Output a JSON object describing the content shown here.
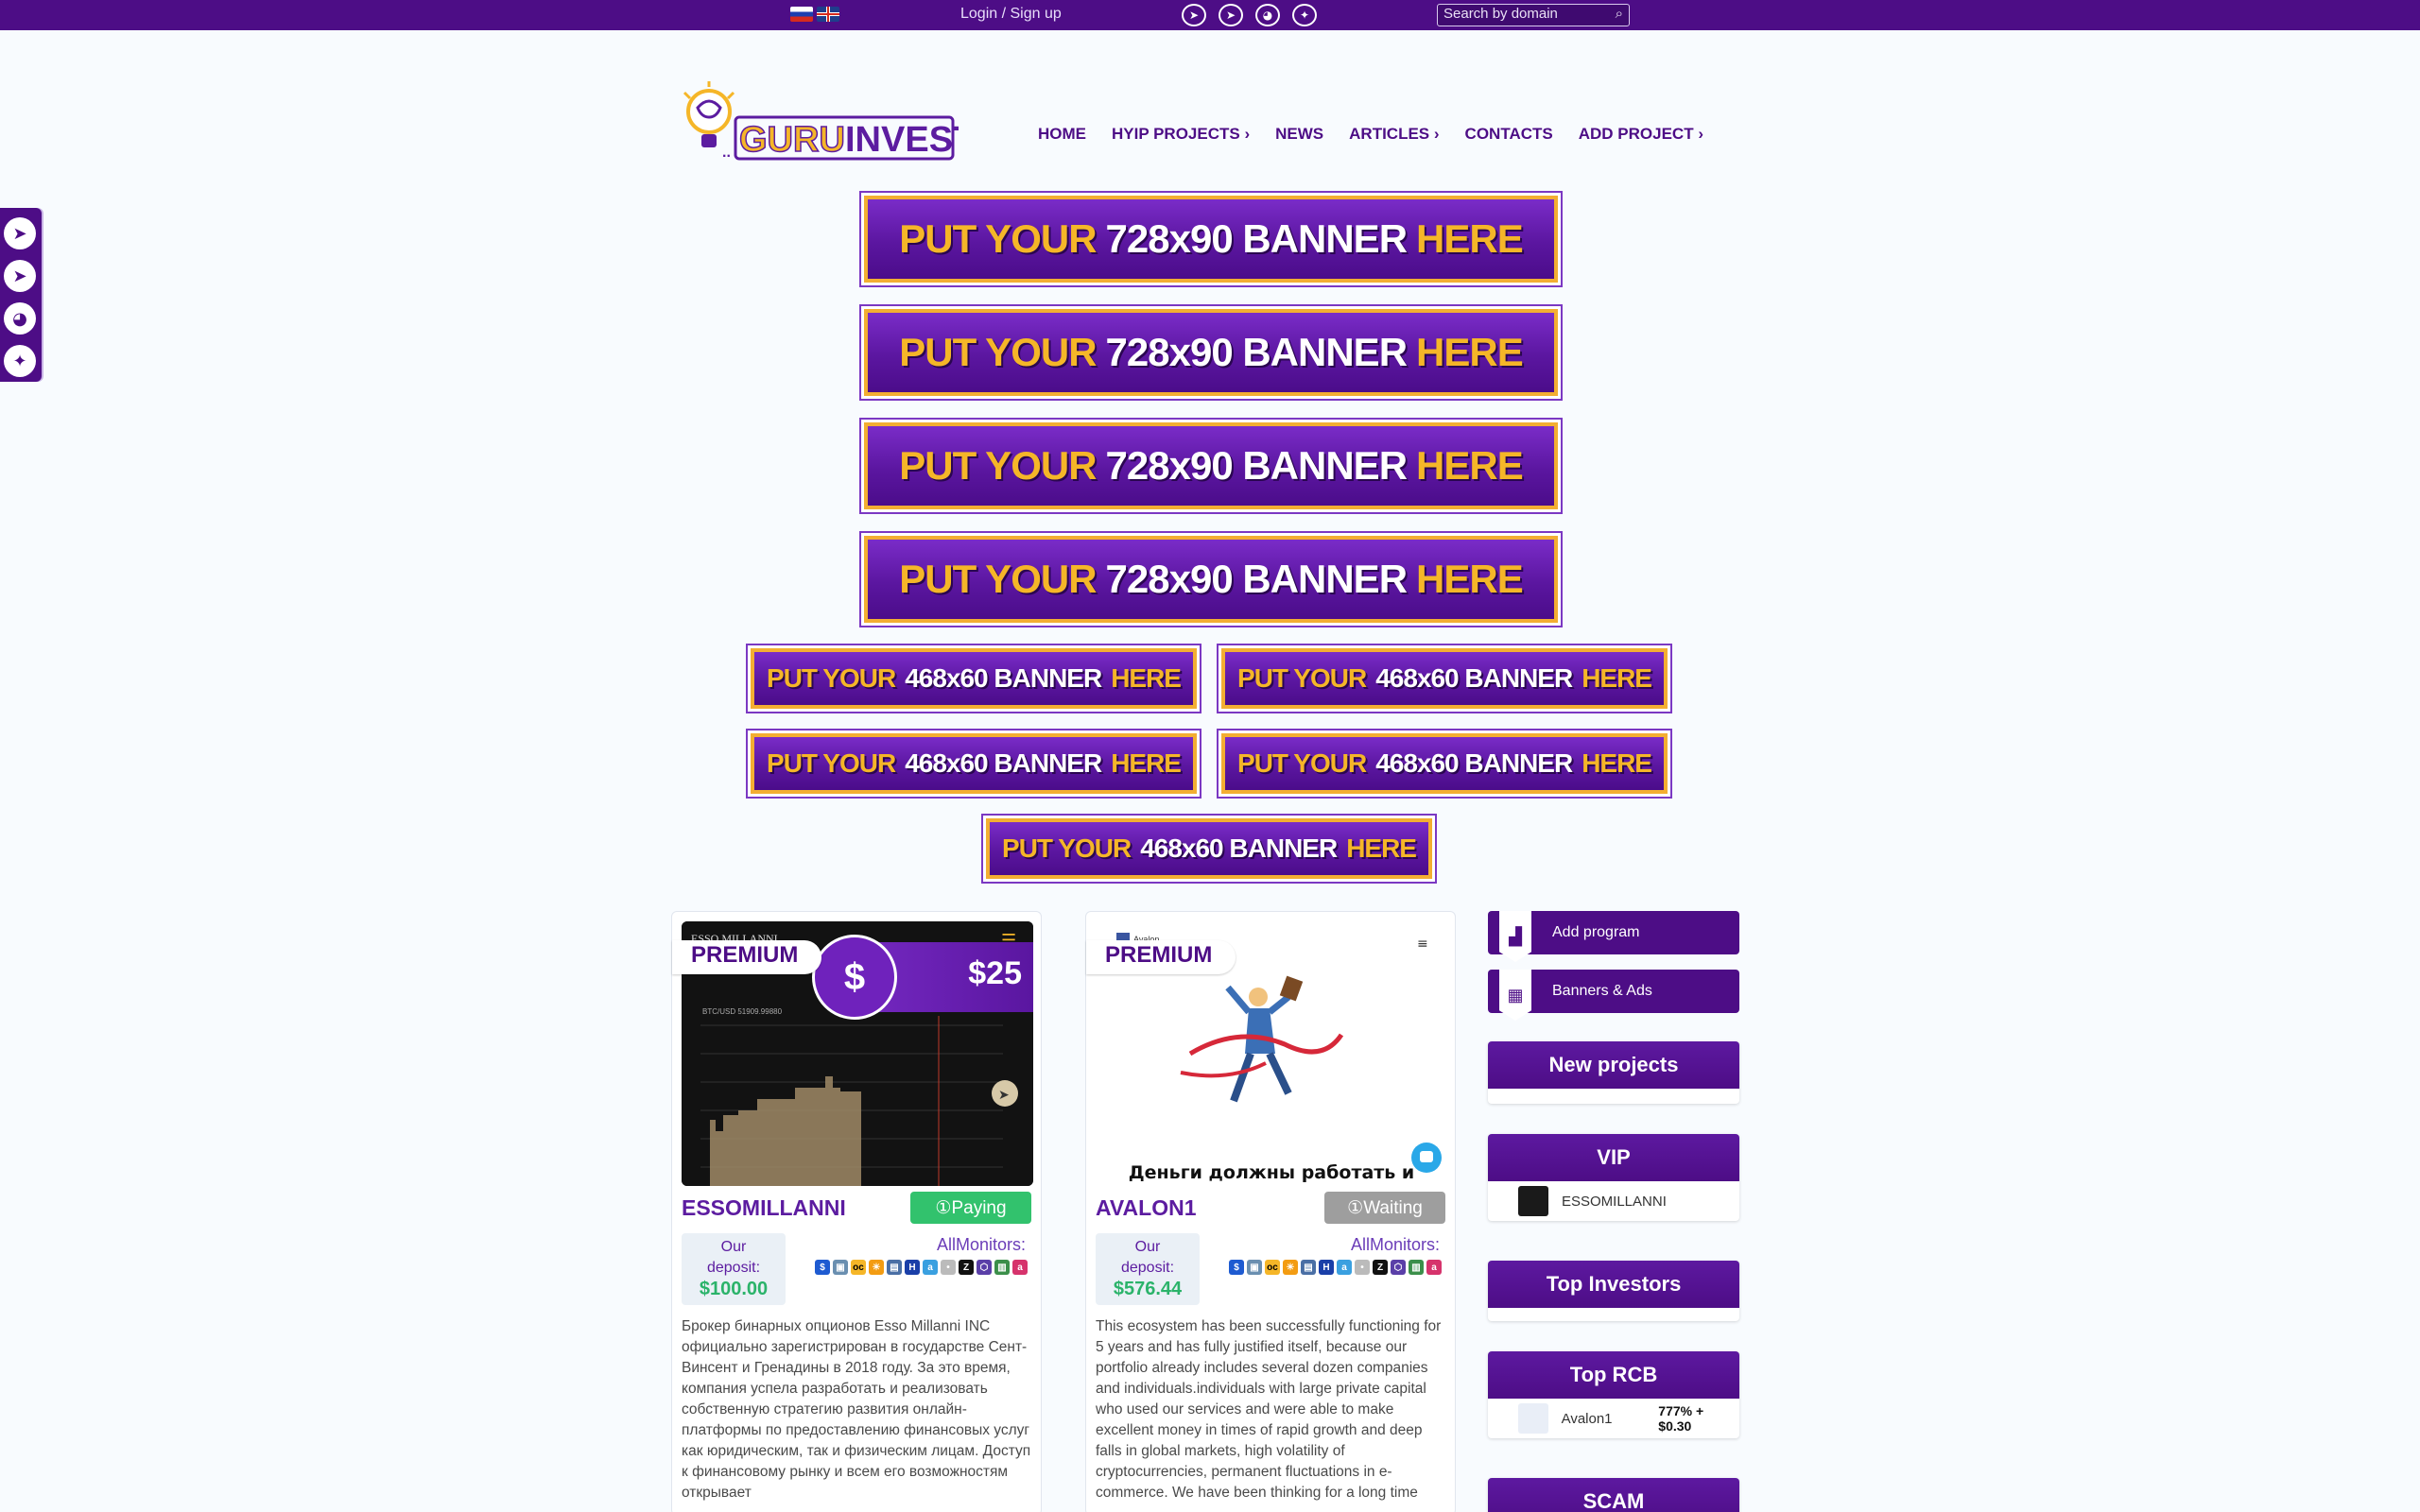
{
  "topbar": {
    "login": "Login / Sign up",
    "search_placeholder": "Search by domain",
    "languages": [
      "ru-flag",
      "uk-flag"
    ],
    "socials": [
      "telegram-icon",
      "telegram-icon",
      "chat-icon",
      "twitter-icon"
    ]
  },
  "logo": {
    "text_a": "GURU",
    "text_b": "INVEST"
  },
  "nav": {
    "items": [
      {
        "label": "HOME"
      },
      {
        "label": "HYIP PROJECTS",
        "arrow": "›"
      },
      {
        "label": "NEWS"
      },
      {
        "label": "ARTICLES",
        "arrow": "›"
      },
      {
        "label": "CONTACTS"
      },
      {
        "label": "ADD PROJECT",
        "arrow": "›"
      }
    ]
  },
  "banners": {
    "big": {
      "put": "PUT YOUR",
      "size": "728x90 BANNER",
      "here": "HERE"
    },
    "small": {
      "put": "PUT YOUR",
      "size": "468x60 BANNER",
      "here": "HERE"
    }
  },
  "sidebar_icons": [
    "telegram-icon",
    "telegram-icon",
    "chat-icon",
    "twitter-icon"
  ],
  "projects": [
    {
      "premium": "PREMIUM",
      "name": "ESSOMILLANNI",
      "status": "①Paying",
      "deposit_label_1": "Our",
      "deposit_label_2": "deposit:",
      "deposit": "$100.00",
      "allmonitors": "AllMonitors:",
      "image_price": "$25",
      "image_chart_label": "BTC/USD 51909.99880",
      "image_header": "ESSO MILLANNI",
      "description": "Брокер бинарных опционов Esso Millanni INC официально зарегистрирован в государстве Сент-Винсент и Гренадины в 2018 году. За это время, компания успела разработать и реализовать собственную стратегию развития онлайн-платформы по предоставлению финансовых услуг как юридическим, так и физическим лицам. Доступ к финансовому рынку и всем его возможностям открывает"
    },
    {
      "premium": "PREMIUM",
      "name": "AVALON1",
      "status": "①Waiting",
      "deposit_label_1": "Our",
      "deposit_label_2": "deposit:",
      "deposit": "$576.44",
      "allmonitors": "AllMonitors:",
      "image_header": "Avalon",
      "image_caption": "Деньги должны работать и",
      "description": "This ecosystem has been successfully functioning for 5 years and has fully justified itself, because our portfolio already includes several dozen companies and individuals.individuals with large private capital who used our services and were able to make excellent money in times of rapid growth and deep falls in global markets, high volatility of cryptocurrencies, permanent fluctuations in e-commerce. We have been thinking for a long time"
    }
  ],
  "sidebar": {
    "add_program": "Add program",
    "banners_ads": "Banners & Ads",
    "new_projects": "New projects",
    "vip": "VIP",
    "vip_item": "ESSOMILLANNI",
    "top_investors": "Top Investors",
    "top_rcb": "Top RCB",
    "rcb_item": "Avalon1",
    "rcb_value": "777% + $0.30",
    "scam": "SCAM"
  },
  "colors": {
    "brand": "#4d0d86",
    "accent": "#f5b628",
    "paying": "#32c26d",
    "waiting": "#9e9e9e"
  }
}
